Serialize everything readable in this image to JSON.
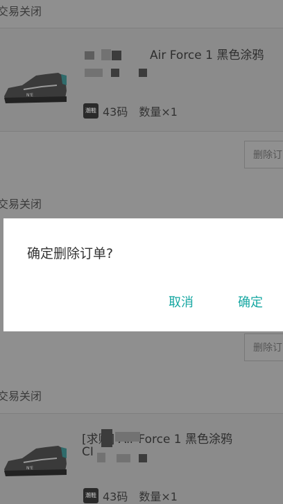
{
  "orders": [
    {
      "status": "交易关闭",
      "product_title": "Air Force 1 黑色涂鸦",
      "brand_badge": "潮鞋",
      "size": "43码",
      "quantity": "数量×1",
      "delete_label": "删除订"
    },
    {
      "status": "交易关闭",
      "delete_label": "删除订"
    },
    {
      "status": "交易关闭",
      "product_title": "[求购] Air Force 1 黑色涂鸦",
      "product_title_line2": "CI",
      "brand_badge": "潮鞋",
      "size": "43码",
      "quantity": "数量×1"
    }
  ],
  "dialog": {
    "message": "确定删除订单?",
    "cancel_label": "取消",
    "confirm_label": "确定",
    "accent_color": "#16a7a2"
  }
}
